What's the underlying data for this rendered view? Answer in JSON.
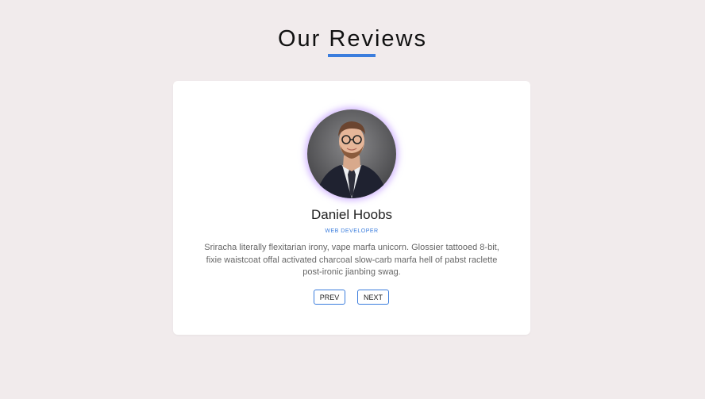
{
  "header": {
    "title": "Our Reviews"
  },
  "review": {
    "name": "Daniel Hoobs",
    "role": "WEB DEVELOPER",
    "text": "Sriracha literally flexitarian irony, vape marfa unicorn. Glossier tattooed 8-bit, fixie waistcoat offal activated charcoal slow-carb marfa hell of pabst raclette post-ironic jianbing swag.",
    "avatar_alt": "Daniel Hoobs"
  },
  "controls": {
    "prev_label": "PREV",
    "next_label": "NEXT"
  },
  "colors": {
    "accent": "#3b7ddd",
    "background": "#f1ebec",
    "card": "#ffffff",
    "avatar_glow": "#b284ff"
  }
}
